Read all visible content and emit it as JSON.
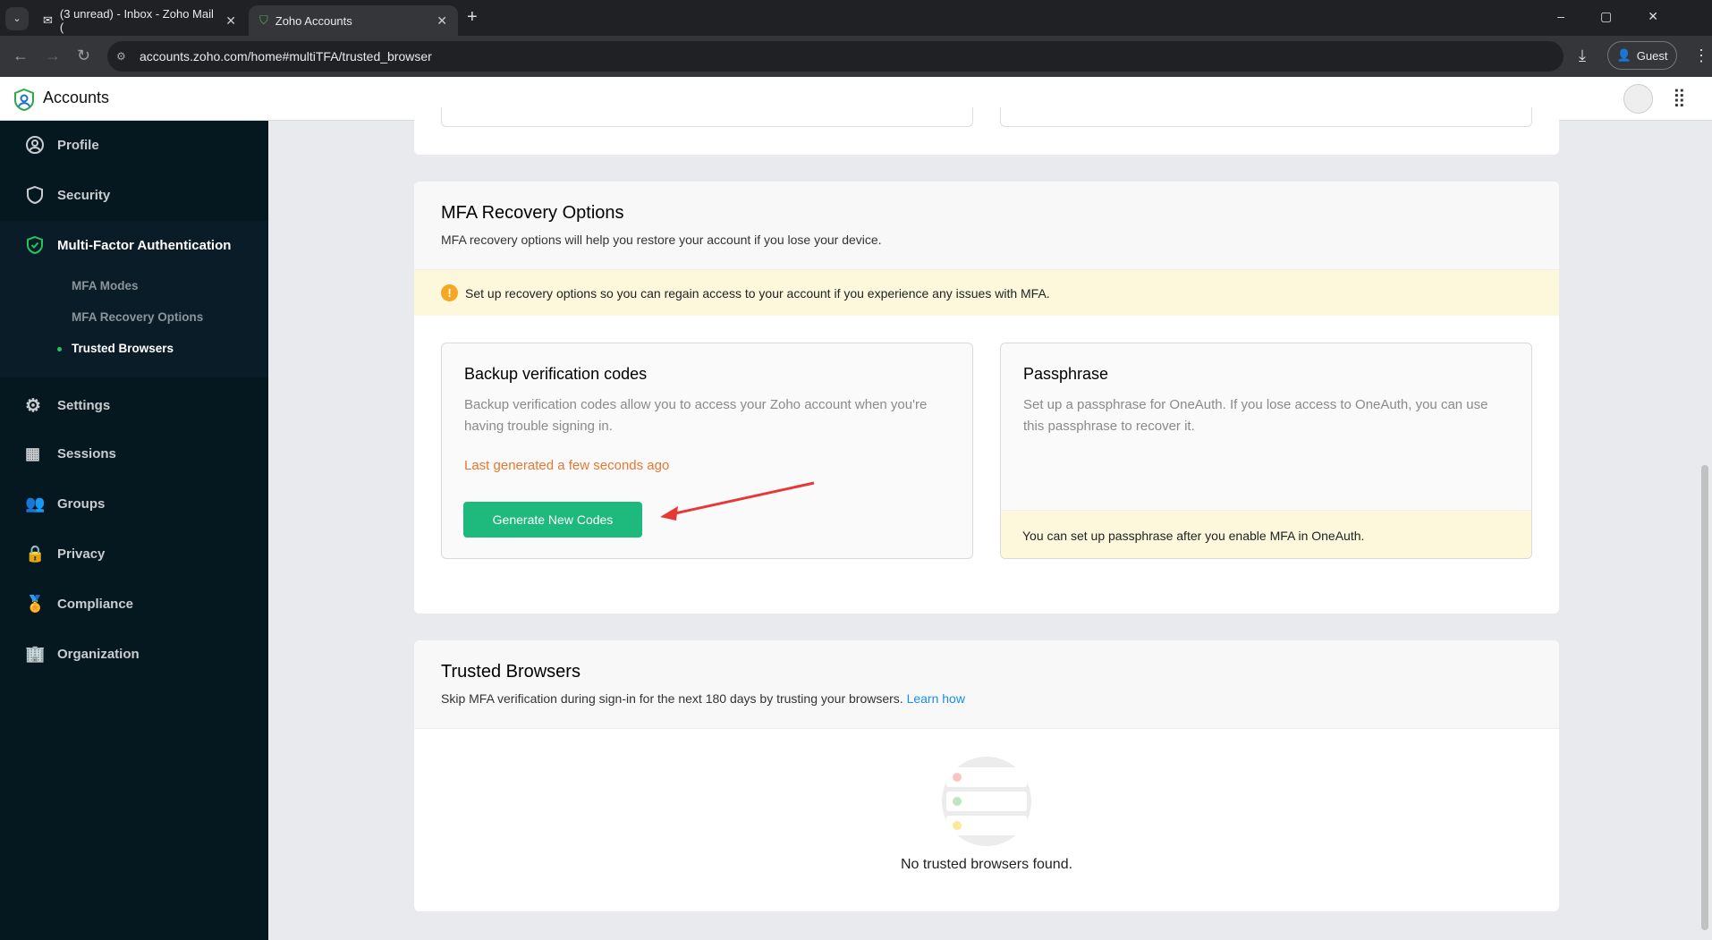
{
  "browser": {
    "tabs": [
      {
        "label": "(3 unread) - Inbox - Zoho Mail ("
      },
      {
        "label": "Zoho Accounts"
      }
    ],
    "url": "accounts.zoho.com/home#multiTFA/trusted_browser",
    "profile": "Guest"
  },
  "app": {
    "title": "Accounts"
  },
  "sidebar": {
    "items": [
      {
        "label": "Profile"
      },
      {
        "label": "Security"
      },
      {
        "label": "Multi-Factor Authentication"
      },
      {
        "label": "Settings"
      },
      {
        "label": "Sessions"
      },
      {
        "label": "Groups"
      },
      {
        "label": "Privacy"
      },
      {
        "label": "Compliance"
      },
      {
        "label": "Organization"
      }
    ],
    "sub_items": [
      {
        "label": "MFA Modes"
      },
      {
        "label": "MFA Recovery Options"
      },
      {
        "label": "Trusted Browsers"
      }
    ]
  },
  "recovery": {
    "title": "MFA Recovery Options",
    "description": "MFA recovery options will help you restore your account if you lose your device.",
    "warning": "Set up recovery options so you can regain access to your account if you experience any issues with MFA.",
    "backup": {
      "title": "Backup verification codes",
      "description": "Backup verification codes allow you to access your Zoho account when you're having trouble signing in.",
      "status": "Last generated a few seconds ago",
      "button": "Generate New Codes"
    },
    "passphrase": {
      "title": "Passphrase",
      "description": "Set up a passphrase for OneAuth. If you lose access to OneAuth, you can use this passphrase to recover it.",
      "note": "You can set up passphrase after you enable MFA in OneAuth."
    }
  },
  "trusted": {
    "title": "Trusted Browsers",
    "description": "Skip MFA verification during sign-in for the next 180 days by trusting your browsers.",
    "link": "Learn how",
    "empty": "No trusted browsers found."
  },
  "colors": {
    "accent": "#1eb97d",
    "warning": "#f5a623",
    "status": "#e8772e",
    "link": "#1a8ceb",
    "sidebar": "#051820"
  }
}
